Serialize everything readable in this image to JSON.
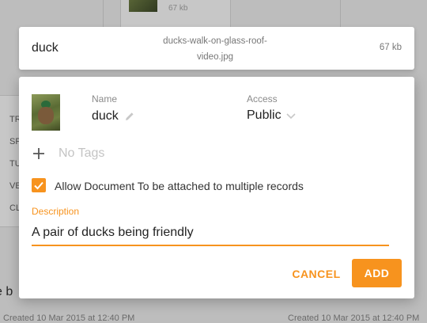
{
  "file": {
    "title": "duck",
    "filename": "ducks-walk-on-glass-roof-video.jpg",
    "size": "67 kb"
  },
  "form": {
    "name_label": "Name",
    "name_value": "duck",
    "access_label": "Access",
    "access_value": "Public",
    "tags_placeholder": "No Tags",
    "checkbox_label": "Allow Document To be attached to multiple records",
    "checkbox_checked": true,
    "description_label": "Description",
    "description_value": "A pair of ducks being friendly"
  },
  "actions": {
    "cancel_label": "CANCEL",
    "add_label": "ADD"
  },
  "background": {
    "card_meta_size": "67 kb",
    "left_items": [
      "TR",
      "SP",
      "TU",
      "VE",
      "CL"
    ],
    "bottom_text": "e b",
    "created_left": "Created 10 Mar 2015 at 12:40 PM",
    "created_right": "Created 10 Mar 2015 at 12:40 PM"
  },
  "colors": {
    "accent": "#f7931e",
    "overlay": "rgba(0,0,0,0.22)"
  }
}
